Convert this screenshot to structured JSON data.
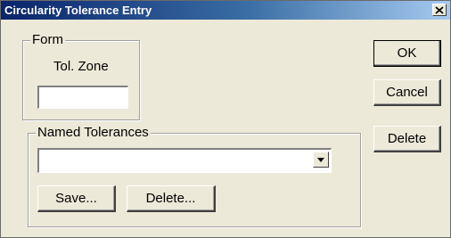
{
  "window": {
    "title": "Circularity Tolerance Entry",
    "close_glyph": "×"
  },
  "form_group": {
    "legend": "Form",
    "tol_zone_label": "Tol. Zone",
    "tol_zone_value": ""
  },
  "named_tolerances": {
    "legend": "Named Tolerances",
    "selected_value": "",
    "save_label": "Save...",
    "delete_label": "Delete..."
  },
  "actions": {
    "ok_label": "OK",
    "cancel_label": "Cancel",
    "delete_label": "Delete"
  },
  "icons": {
    "close": "close-icon",
    "dropdown": "chevron-down-icon"
  }
}
